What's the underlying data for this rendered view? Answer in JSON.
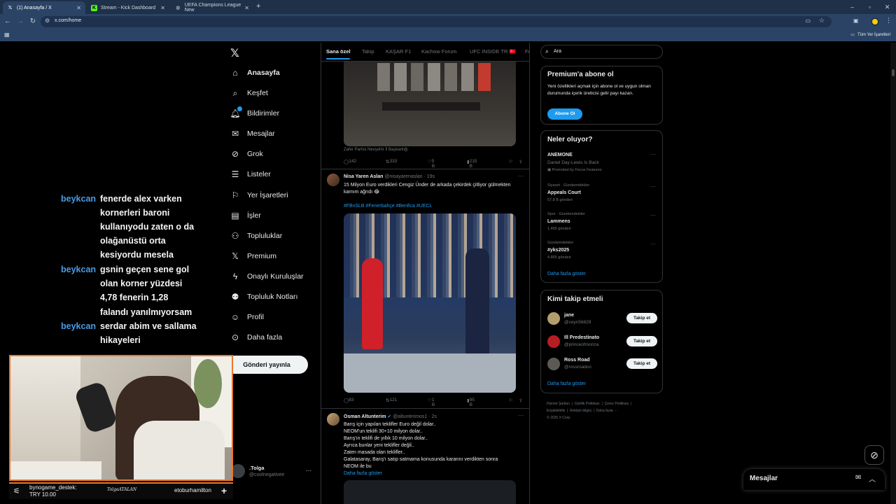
{
  "browser": {
    "tabs": [
      {
        "title": "(1) Anasayfa / X",
        "icon": "x-logo-icon",
        "active": true
      },
      {
        "title": "Stream - Kick Dashboard",
        "icon": "kick-logo-icon",
        "active": false
      },
      {
        "title": "UEFA Champions League New",
        "icon": "globe-icon",
        "active": false
      }
    ],
    "new_tab": "+",
    "url": "x.com/home",
    "bookmarks_label": "Tüm Yer İşaretleri"
  },
  "sidebar": {
    "items": [
      {
        "label": "Anasayfa",
        "icon": "home-icon"
      },
      {
        "label": "Keşfet",
        "icon": "search-icon"
      },
      {
        "label": "Bildirimler",
        "icon": "bell-icon"
      },
      {
        "label": "Mesajlar",
        "icon": "mail-icon"
      },
      {
        "label": "Grok",
        "icon": "grok-icon"
      },
      {
        "label": "Listeler",
        "icon": "list-icon"
      },
      {
        "label": "Yer İşaretleri",
        "icon": "bookmark-icon"
      },
      {
        "label": "İşler",
        "icon": "briefcase-icon"
      },
      {
        "label": "Topluluklar",
        "icon": "people-icon"
      },
      {
        "label": "Premium",
        "icon": "x-premium-icon"
      },
      {
        "label": "Onaylı Kuruluşlar",
        "icon": "lightning-icon"
      },
      {
        "label": "Topluluk Notları",
        "icon": "notes-icon"
      },
      {
        "label": "Profil",
        "icon": "person-icon"
      },
      {
        "label": "Daha fazla",
        "icon": "more-circle-icon"
      }
    ],
    "post_button": "Gönderi yayınla",
    "account_name": ".Tolga",
    "account_handle": "@coolnegativee",
    "account_more": "···"
  },
  "feed": {
    "tabs": [
      "Sana özel",
      "Takip",
      "KAŞAR F1",
      "Kachow Forum",
      "UFC INSIDE TR 🇹🇷",
      "Fo"
    ],
    "tweet0": {
      "caption": "Zafer Partisi Nevşehir İl Başkanlığı",
      "actions": {
        "reply": "142",
        "retweet": "333",
        "like": "5 B",
        "views": "215 B"
      }
    },
    "tweet1": {
      "name": "Nisa Yaren Aslan",
      "handle": "@nisayarenaslan · 19s",
      "text": "15 Milyon Euro verdikleri Cengiz Ünder de arkada çekirdek çitliyor gülmekten karnım ağrıdı 😂",
      "hashtags": "#FBvSLB #Fenerbahçe #Benfica #UECL",
      "actions": {
        "reply": "83",
        "retweet": "121",
        "like": "1 B",
        "views": "95 B"
      }
    },
    "tweet2": {
      "name": "Osman Altunterim",
      "handle": "@altunterimos1 · 2s",
      "lines": [
        "Barış için yapılan teklifler Euro değil dolar..",
        "NEOM'un teklifi 30+10 milyon dolar..",
        "Barış'ın teklifi de yıllık 10 milyon dolar..",
        "Ayrıca bunlar yeni teklifler değil..",
        "Zaten masada olan teklifler..",
        "Galatasaray, Barış'ı satıp satmama konusunda kararını verdikten sonra",
        "NEOM ile bu"
      ],
      "show_more": "Daha fazla göster"
    },
    "more": "···"
  },
  "right": {
    "search_placeholder": "Ara",
    "premium": {
      "title": "Premium'a abone ol",
      "text": "Yeni özellikleri açmak için abone ol ve uygun olman durumunda içerik üreticisi gelir payı kazan.",
      "button": "Abone Ol"
    },
    "trends": {
      "title": "Neler oluyor?",
      "items": [
        {
          "meta": "",
          "title": "ANEMONE",
          "sub": "Daniel Day-Lewis Is Back",
          "promo": "Promoted by Focus Features"
        },
        {
          "meta": "Siyaset · Gündemdekiler",
          "title": "Appeals Court",
          "sub": "57,8 B gönderi"
        },
        {
          "meta": "Spor · Gündemdekiler",
          "title": "Lammens",
          "sub": "1.405 gönderi"
        },
        {
          "meta": "Gündemdekiler",
          "title": "#yks2025",
          "sub": "4.865 gönderi"
        }
      ],
      "show_more": "Daha fazla göster"
    },
    "follow": {
      "title": "Kimi takip etmeli",
      "items": [
        {
          "name": "jane",
          "handle": "@ceyn56829",
          "button": "Takip et"
        },
        {
          "name": "Ill Predestinato",
          "handle": "@princeofmonza",
          "button": "Takip et"
        },
        {
          "name": "Ross Road",
          "handle": "@rossroadco",
          "button": "Takip et"
        }
      ],
      "show_more": "Daha fazla göster"
    },
    "footer": [
      "Hizmet Şartları",
      "Gizlilik Politikası",
      "Çerez Politikası",
      "Erişilebilirlik",
      "Reklam bilgisi",
      "Daha fazla ···",
      "© 2025 X Corp."
    ],
    "messages_dock": "Mesajlar"
  },
  "overlay": {
    "chat": [
      {
        "user": "beykcan",
        "text": "fenerde alex varken"
      },
      {
        "user": "",
        "text": "kornerleri baroni"
      },
      {
        "user": "",
        "text": "kullanıyodu zaten o da"
      },
      {
        "user": "",
        "text": "olağanüstü orta"
      },
      {
        "user": "",
        "text": "kesiyordu mesela"
      },
      {
        "user": "beykcan",
        "text": "gsnin geçen sene gol"
      },
      {
        "user": "",
        "text": "olan korner yüzdesi"
      },
      {
        "user": "",
        "text": "4,78 fenerin 1,28"
      },
      {
        "user": "",
        "text": "falandı yanılmıyorsam"
      },
      {
        "user": "beykcan",
        "text": "serdar abim ve sallama"
      },
      {
        "user": "",
        "text": "hikayeleri"
      }
    ],
    "ticker": {
      "donor": "bynogame_destek:",
      "amount": "TRY 10.00",
      "signature": "TolgaATALAN",
      "follower": "etoburhamilton",
      "plus": "+"
    }
  },
  "colors": {
    "accent": "#1d9bf0",
    "overlay_border": "#e8772e",
    "chat_name": "#4a9be4",
    "chrome": "#2b4466"
  }
}
